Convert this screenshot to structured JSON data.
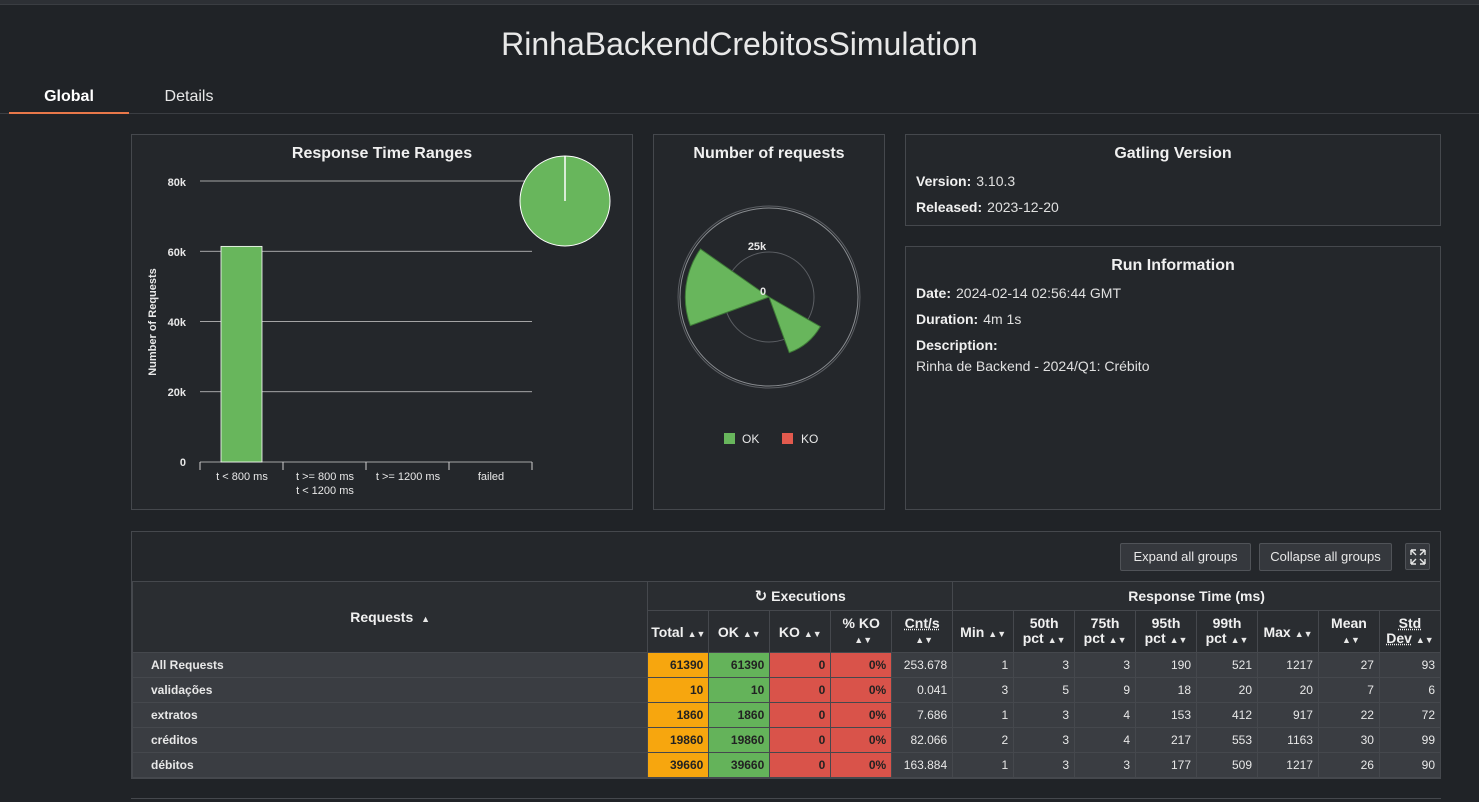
{
  "app": {
    "title": "RinhaBackendCrebitosSimulation"
  },
  "tabs": {
    "global": "Global",
    "details": "Details"
  },
  "ranges_panel": {
    "title": "Response Time Ranges",
    "ylabel": "Number of Requests",
    "ytick_labels": [
      "80k",
      "60k",
      "40k",
      "20k",
      "0"
    ],
    "categories": [
      "t < 800 ms",
      "t >= 800 ms",
      "t < 1200 ms",
      "t >= 1200 ms",
      "failed"
    ]
  },
  "requests_panel": {
    "title": "Number of requests",
    "ring_labels": [
      "25k",
      "0"
    ],
    "legend": [
      "OK",
      "KO"
    ]
  },
  "version_panel": {
    "title": "Gatling Version",
    "version_label": "Version:",
    "version": "3.10.3",
    "released_label": "Released:",
    "released": "2023-12-20"
  },
  "run_panel": {
    "title": "Run Information",
    "date_label": "Date:",
    "date": "2024-02-14 02:56:44 GMT",
    "duration_label": "Duration:",
    "duration": "4m 1s",
    "description_label": "Description:",
    "description": "Rinha de Backend - 2024/Q1: Crébito"
  },
  "chart_data": [
    {
      "type": "bar",
      "title": "Response Time Ranges",
      "ylabel": "Number of Requests",
      "categories": [
        "t < 800 ms",
        "t >= 800 ms t < 1200 ms",
        "t >= 1200 ms",
        "failed"
      ],
      "values": [
        61390,
        0,
        0,
        0
      ],
      "ylim": [
        0,
        80000
      ],
      "colors": [
        "#68b65c",
        "#68b65c",
        "#68b65c",
        "#e25a4e"
      ]
    },
    {
      "type": "pie",
      "title": "Number of requests",
      "series": [
        {
          "name": "OK",
          "values": [
            61390
          ]
        },
        {
          "name": "KO",
          "values": [
            0
          ]
        }
      ],
      "colors": {
        "ok": "#68b65c",
        "ko": "#e25a4e"
      }
    }
  ],
  "stats": {
    "buttons": {
      "expand": "Expand all groups",
      "collapse": "Collapse all groups"
    },
    "group_headers": {
      "executions": "Executions",
      "response_time": "Response Time (ms)"
    },
    "columns": {
      "requests": "Requests",
      "total": "Total",
      "ok": "OK",
      "ko": "KO",
      "pct_ko": "% KO",
      "cnt_s": "Cnt/s",
      "min": "Min",
      "p50_a": "50th",
      "p50_b": "pct",
      "p75_a": "75th",
      "p75_b": "pct",
      "p95_a": "95th",
      "p95_b": "pct",
      "p99_a": "99th",
      "p99_b": "pct",
      "max": "Max",
      "mean": "Mean",
      "std_a": "Std",
      "std_b": "Dev"
    },
    "rows": [
      {
        "name": "All Requests",
        "total": "61390",
        "ok": "61390",
        "ko": "0",
        "pct_ko": "0%",
        "cnt": "253.678",
        "min": "1",
        "p50": "3",
        "p75": "3",
        "p95": "190",
        "p99": "521",
        "max": "1217",
        "mean": "27",
        "std": "93"
      },
      {
        "name": "validações",
        "total": "10",
        "ok": "10",
        "ko": "0",
        "pct_ko": "0%",
        "cnt": "0.041",
        "min": "3",
        "p50": "5",
        "p75": "9",
        "p95": "18",
        "p99": "20",
        "max": "20",
        "mean": "7",
        "std": "6"
      },
      {
        "name": "extratos",
        "total": "1860",
        "ok": "1860",
        "ko": "0",
        "pct_ko": "0%",
        "cnt": "7.686",
        "min": "1",
        "p50": "3",
        "p75": "4",
        "p95": "153",
        "p99": "412",
        "max": "917",
        "mean": "22",
        "std": "72"
      },
      {
        "name": "créditos",
        "total": "19860",
        "ok": "19860",
        "ko": "0",
        "pct_ko": "0%",
        "cnt": "82.066",
        "min": "2",
        "p50": "3",
        "p75": "4",
        "p95": "217",
        "p99": "553",
        "max": "1163",
        "mean": "30",
        "std": "99"
      },
      {
        "name": "débitos",
        "total": "39660",
        "ok": "39660",
        "ko": "0",
        "pct_ko": "0%",
        "cnt": "163.884",
        "min": "1",
        "p50": "3",
        "p75": "3",
        "p95": "177",
        "p99": "509",
        "max": "1217",
        "mean": "26",
        "std": "90"
      }
    ]
  }
}
